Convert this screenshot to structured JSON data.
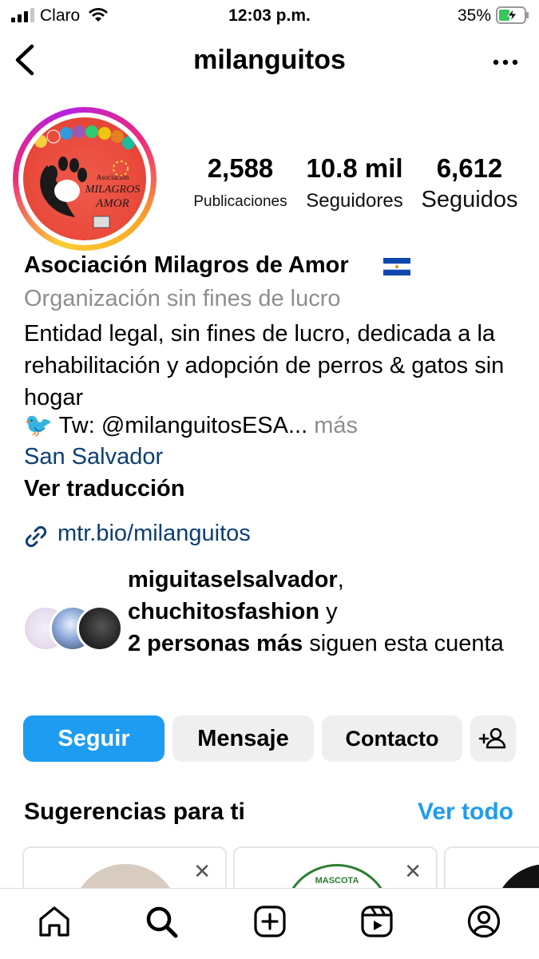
{
  "status_bar": {
    "carrier": "Claro",
    "time": "12:03 p.m.",
    "battery": "35%"
  },
  "header": {
    "username": "milanguitos"
  },
  "avatar": {
    "logo_text": [
      "Asociación",
      "MILAGROS",
      "AMOR"
    ]
  },
  "stats": [
    {
      "value": "2,588",
      "label": "Publicaciones"
    },
    {
      "value": "10.8 mil",
      "label": "Seguidores"
    },
    {
      "value": "6,612",
      "label": "Seguidos"
    }
  ],
  "bio": {
    "name": "Asociación Milagros de Amor",
    "category": "Organización sin fines de lucro",
    "description": "Entidad legal, sin fines de lucro, dedicada a la rehabilitación y adopción de perros & gatos sin hogar",
    "tw_prefix": "🐦",
    "tw_text": "Tw: @milanguitosESA...",
    "more": "más",
    "location": "San Salvador",
    "translate": "Ver traducción",
    "link": "mtr.bio/milanguitos"
  },
  "followed_by": {
    "user1": "miguitaselsalvador",
    "sep1": ",",
    "user2": "chuchitosfashion",
    "sep2": " y",
    "others": "2 personas más",
    "suffix": " siguen esta cuenta"
  },
  "buttons": {
    "follow": "Seguir",
    "message": "Mensaje",
    "contact": "Contacto"
  },
  "suggestions": {
    "title": "Sugerencias para ti",
    "see_all": "Ver todo",
    "close_glyph": "✕",
    "card2_text": "MASCOTA"
  },
  "colors": {
    "accent": "#1e9cf1",
    "link": "#0b3f72",
    "muted": "#8e8e8e",
    "button_gray": "#efefef"
  },
  "icons": [
    "back-arrow-icon",
    "more-options-icon",
    "link-icon",
    "add-person-icon",
    "home-icon",
    "search-icon",
    "create-post-icon",
    "reels-icon",
    "profile-icon"
  ]
}
